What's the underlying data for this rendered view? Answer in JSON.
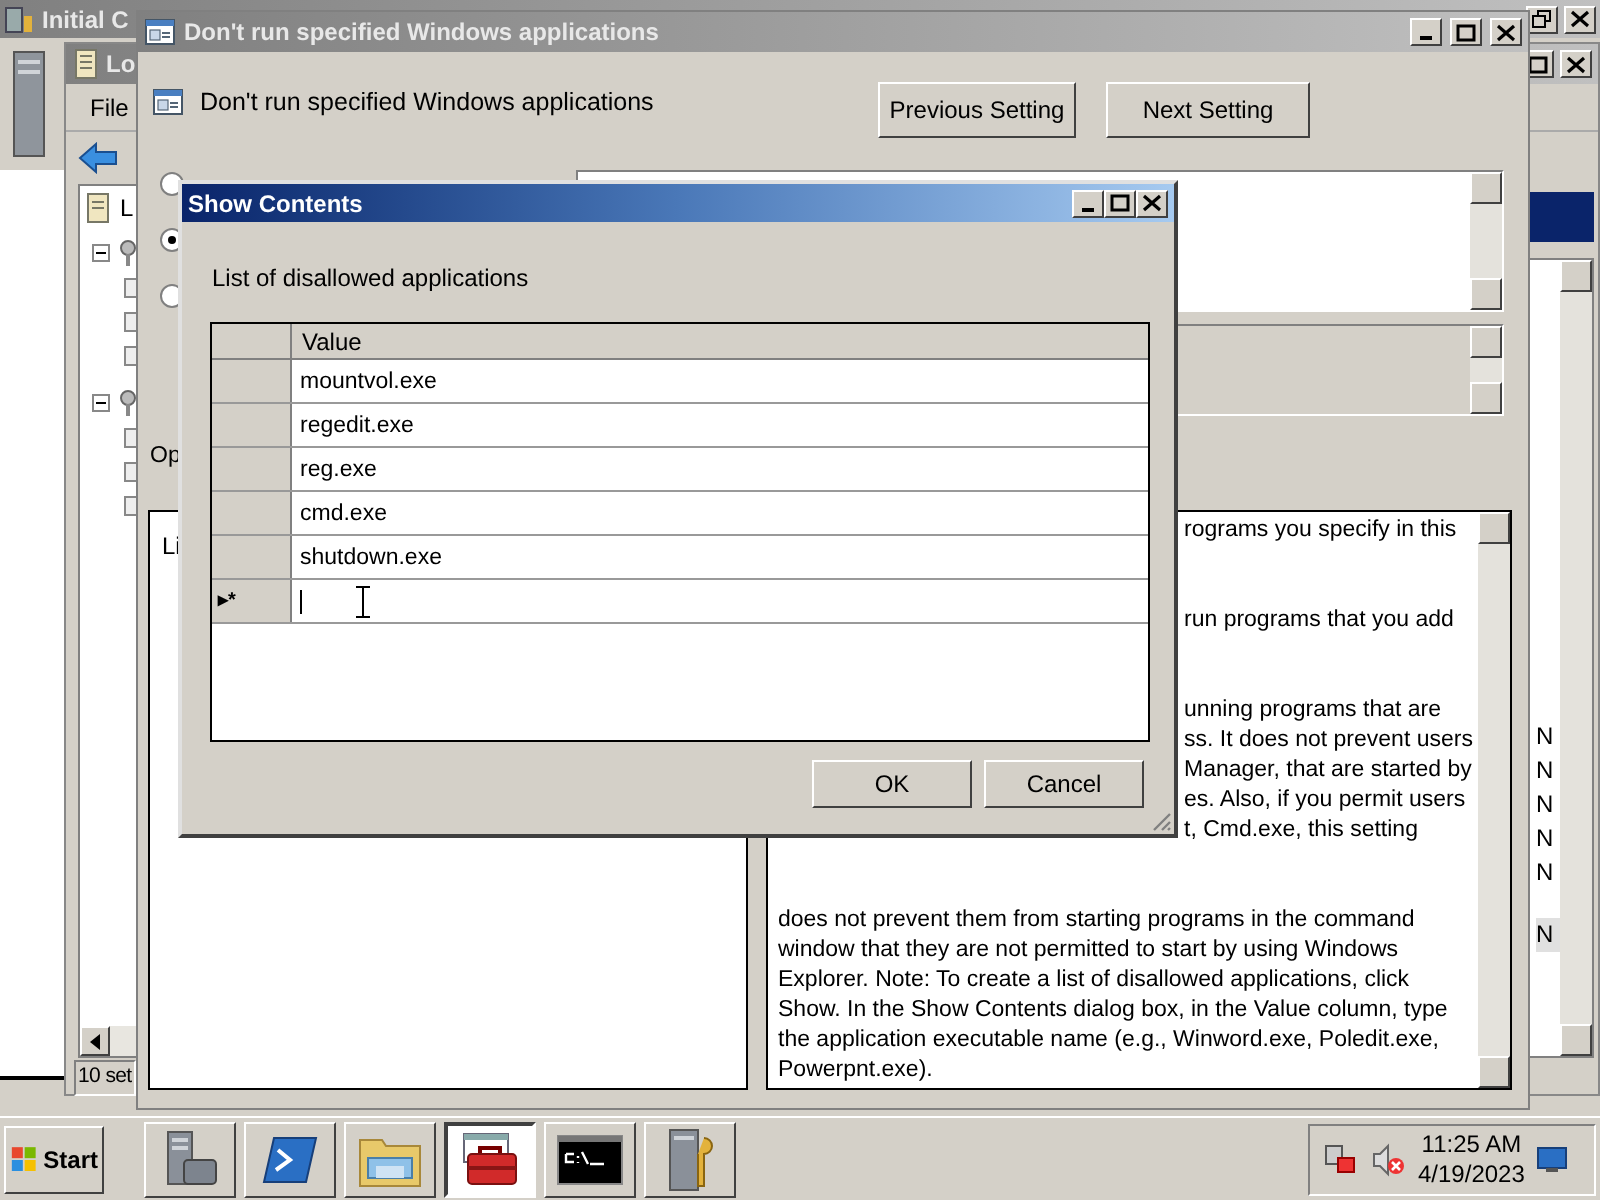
{
  "back_window": {
    "title": "Initial C"
  },
  "editor_window": {
    "title": "Lo",
    "menu": [
      "File"
    ],
    "tree": [
      {
        "label": "L",
        "selected": false
      }
    ],
    "tree_groups": [
      {
        "expanded": true
      },
      {
        "expanded": true
      }
    ],
    "list_rows": [
      {
        "text": "N",
        "selected": false
      },
      {
        "text": "N",
        "selected": false
      },
      {
        "text": "N",
        "selected": false
      },
      {
        "text": "N",
        "selected": false
      },
      {
        "text": "N",
        "selected": false
      }
    ],
    "list_tail": [
      {
        "text": "N",
        "selected": true
      }
    ],
    "status": "10 set"
  },
  "policy_dialog": {
    "title": "Don't run specified Windows applications",
    "heading": "Don't run specified Windows applications",
    "buttons": [
      "Previous Setting",
      "Next Setting"
    ],
    "radios": [
      {
        "selected": false
      },
      {
        "selected": true
      },
      {
        "selected": false
      }
    ],
    "options_label": "Op",
    "options_text": "Li",
    "help": [
      [
        "rograms you specify in this"
      ],
      [
        "run programs that you add"
      ],
      [
        "unning programs that are",
        "ss. It does not prevent users",
        "Manager, that are started by",
        "es. Also, if you permit users",
        "t, Cmd.exe, this setting"
      ],
      [
        "does not prevent them from starting programs in the command",
        "window that they are not permitted to start by using Windows",
        "Explorer. Note: To create a list of disallowed applications, click",
        "Show. In the Show Contents dialog box, in the Value column, type",
        "the application executable name (e.g., Winword.exe, Poledit.exe,",
        "Powerpnt.exe)."
      ]
    ]
  },
  "show_contents": {
    "title": "Show Contents",
    "label": "List of disallowed applications",
    "column": "Value",
    "rows": [
      {
        "value": "mountvol.exe"
      },
      {
        "value": "regedit.exe"
      },
      {
        "value": "reg.exe"
      },
      {
        "value": "cmd.exe"
      },
      {
        "value": "shutdown.exe"
      }
    ],
    "new_row": {
      "marker": "▸*"
    },
    "buttons": [
      "OK",
      "Cancel"
    ]
  },
  "taskbar": {
    "start": "Start",
    "apps": [
      {
        "kind": "server",
        "active": false
      },
      {
        "kind": "shell",
        "active": false
      },
      {
        "kind": "folder",
        "active": false
      },
      {
        "kind": "toolbox",
        "active": true
      },
      {
        "kind": "console",
        "active": false
      },
      {
        "kind": "tools",
        "active": false
      }
    ],
    "time": "11:25 AM",
    "date": "4/19/2023"
  }
}
